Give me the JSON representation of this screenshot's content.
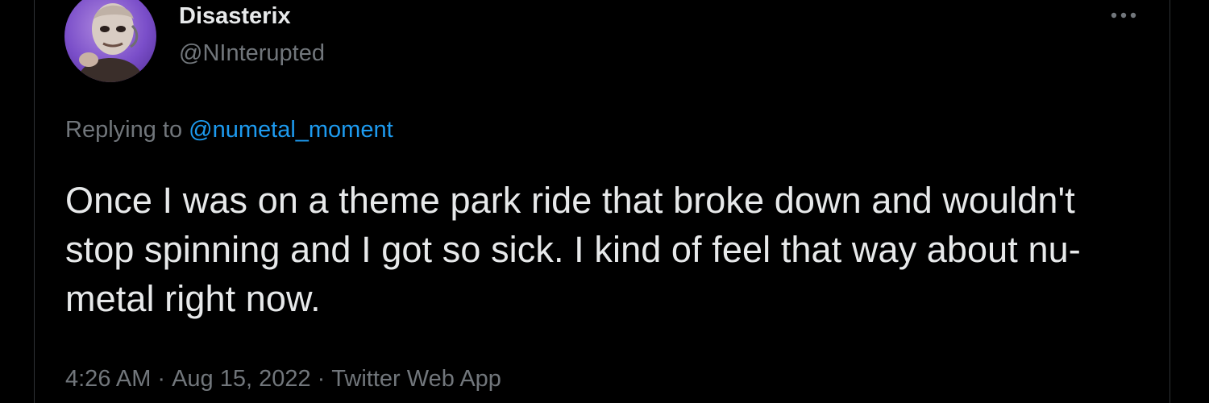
{
  "tweet": {
    "author": {
      "display_name": "Disasterix",
      "handle": "@NInterupted",
      "avatar_icon": "avatar-masked-figure"
    },
    "more_icon": "more-horizontal-icon",
    "replying": {
      "prefix": "Replying to",
      "mention": "@numetal_moment"
    },
    "text": "Once I was on a theme park ride that broke down and wouldn't stop spinning and I got so sick. I kind of feel that way about nu-metal right now.",
    "meta": {
      "time": "4:26 AM",
      "separator": "·",
      "date": "Aug 15, 2022",
      "source": "Twitter Web App"
    }
  },
  "colors": {
    "background": "#000000",
    "primary_text": "#e7e9ea",
    "secondary_text": "#71767b",
    "link": "#1d9bf0"
  }
}
